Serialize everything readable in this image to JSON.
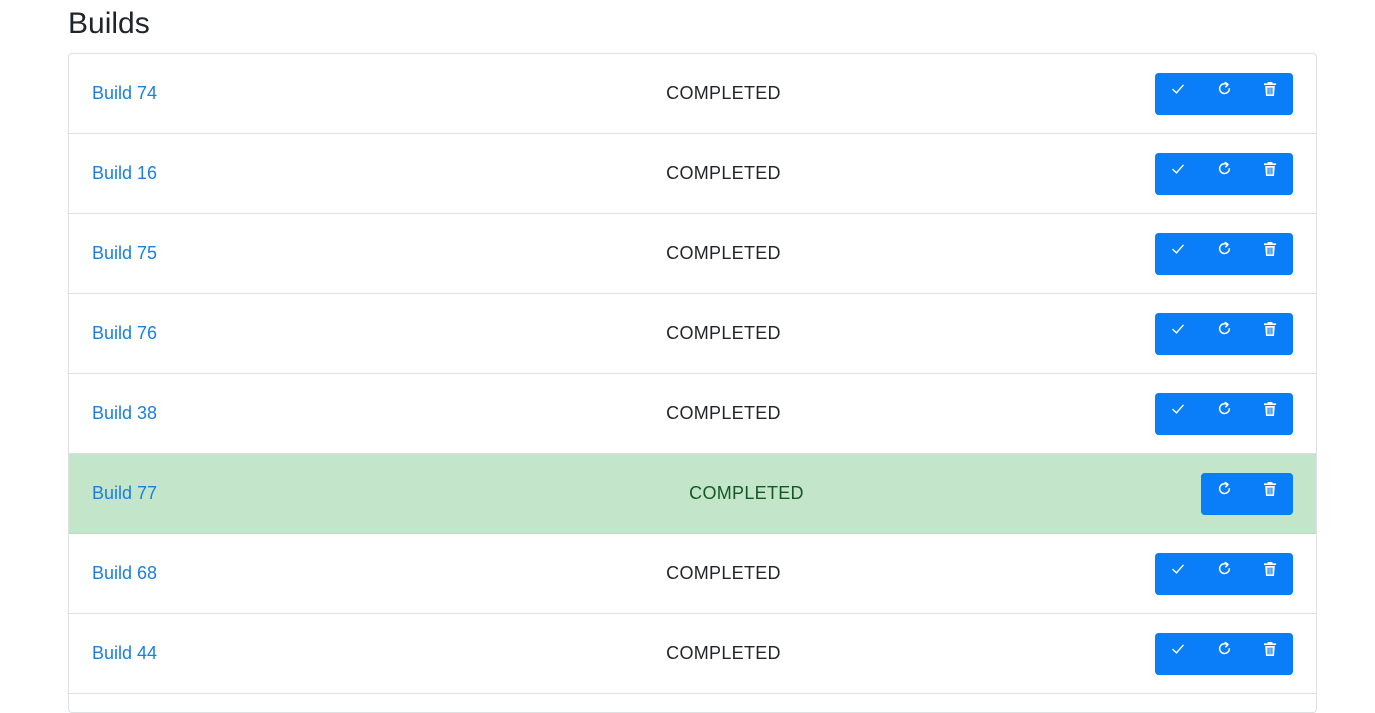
{
  "page": {
    "title": "Builds"
  },
  "builds": [
    {
      "name": "Build 74",
      "status": "COMPLETED",
      "highlighted": false,
      "actions": [
        "approve",
        "retry",
        "delete"
      ]
    },
    {
      "name": "Build 16",
      "status": "COMPLETED",
      "highlighted": false,
      "actions": [
        "approve",
        "retry",
        "delete"
      ]
    },
    {
      "name": "Build 75",
      "status": "COMPLETED",
      "highlighted": false,
      "actions": [
        "approve",
        "retry",
        "delete"
      ]
    },
    {
      "name": "Build 76",
      "status": "COMPLETED",
      "highlighted": false,
      "actions": [
        "approve",
        "retry",
        "delete"
      ]
    },
    {
      "name": "Build 38",
      "status": "COMPLETED",
      "highlighted": false,
      "actions": [
        "approve",
        "retry",
        "delete"
      ]
    },
    {
      "name": "Build 77",
      "status": "COMPLETED",
      "highlighted": true,
      "actions": [
        "retry",
        "delete"
      ]
    },
    {
      "name": "Build 68",
      "status": "COMPLETED",
      "highlighted": false,
      "actions": [
        "approve",
        "retry",
        "delete"
      ]
    },
    {
      "name": "Build 44",
      "status": "COMPLETED",
      "highlighted": false,
      "actions": [
        "approve",
        "retry",
        "delete"
      ]
    }
  ],
  "icons": {
    "approve": "check-icon",
    "retry": "refresh-icon",
    "delete": "trash-icon"
  },
  "colors": {
    "link": "#1a7fe0",
    "button": "#0a7ef9",
    "highlight_bg": "#c3e6cb",
    "highlight_text": "#155724"
  }
}
